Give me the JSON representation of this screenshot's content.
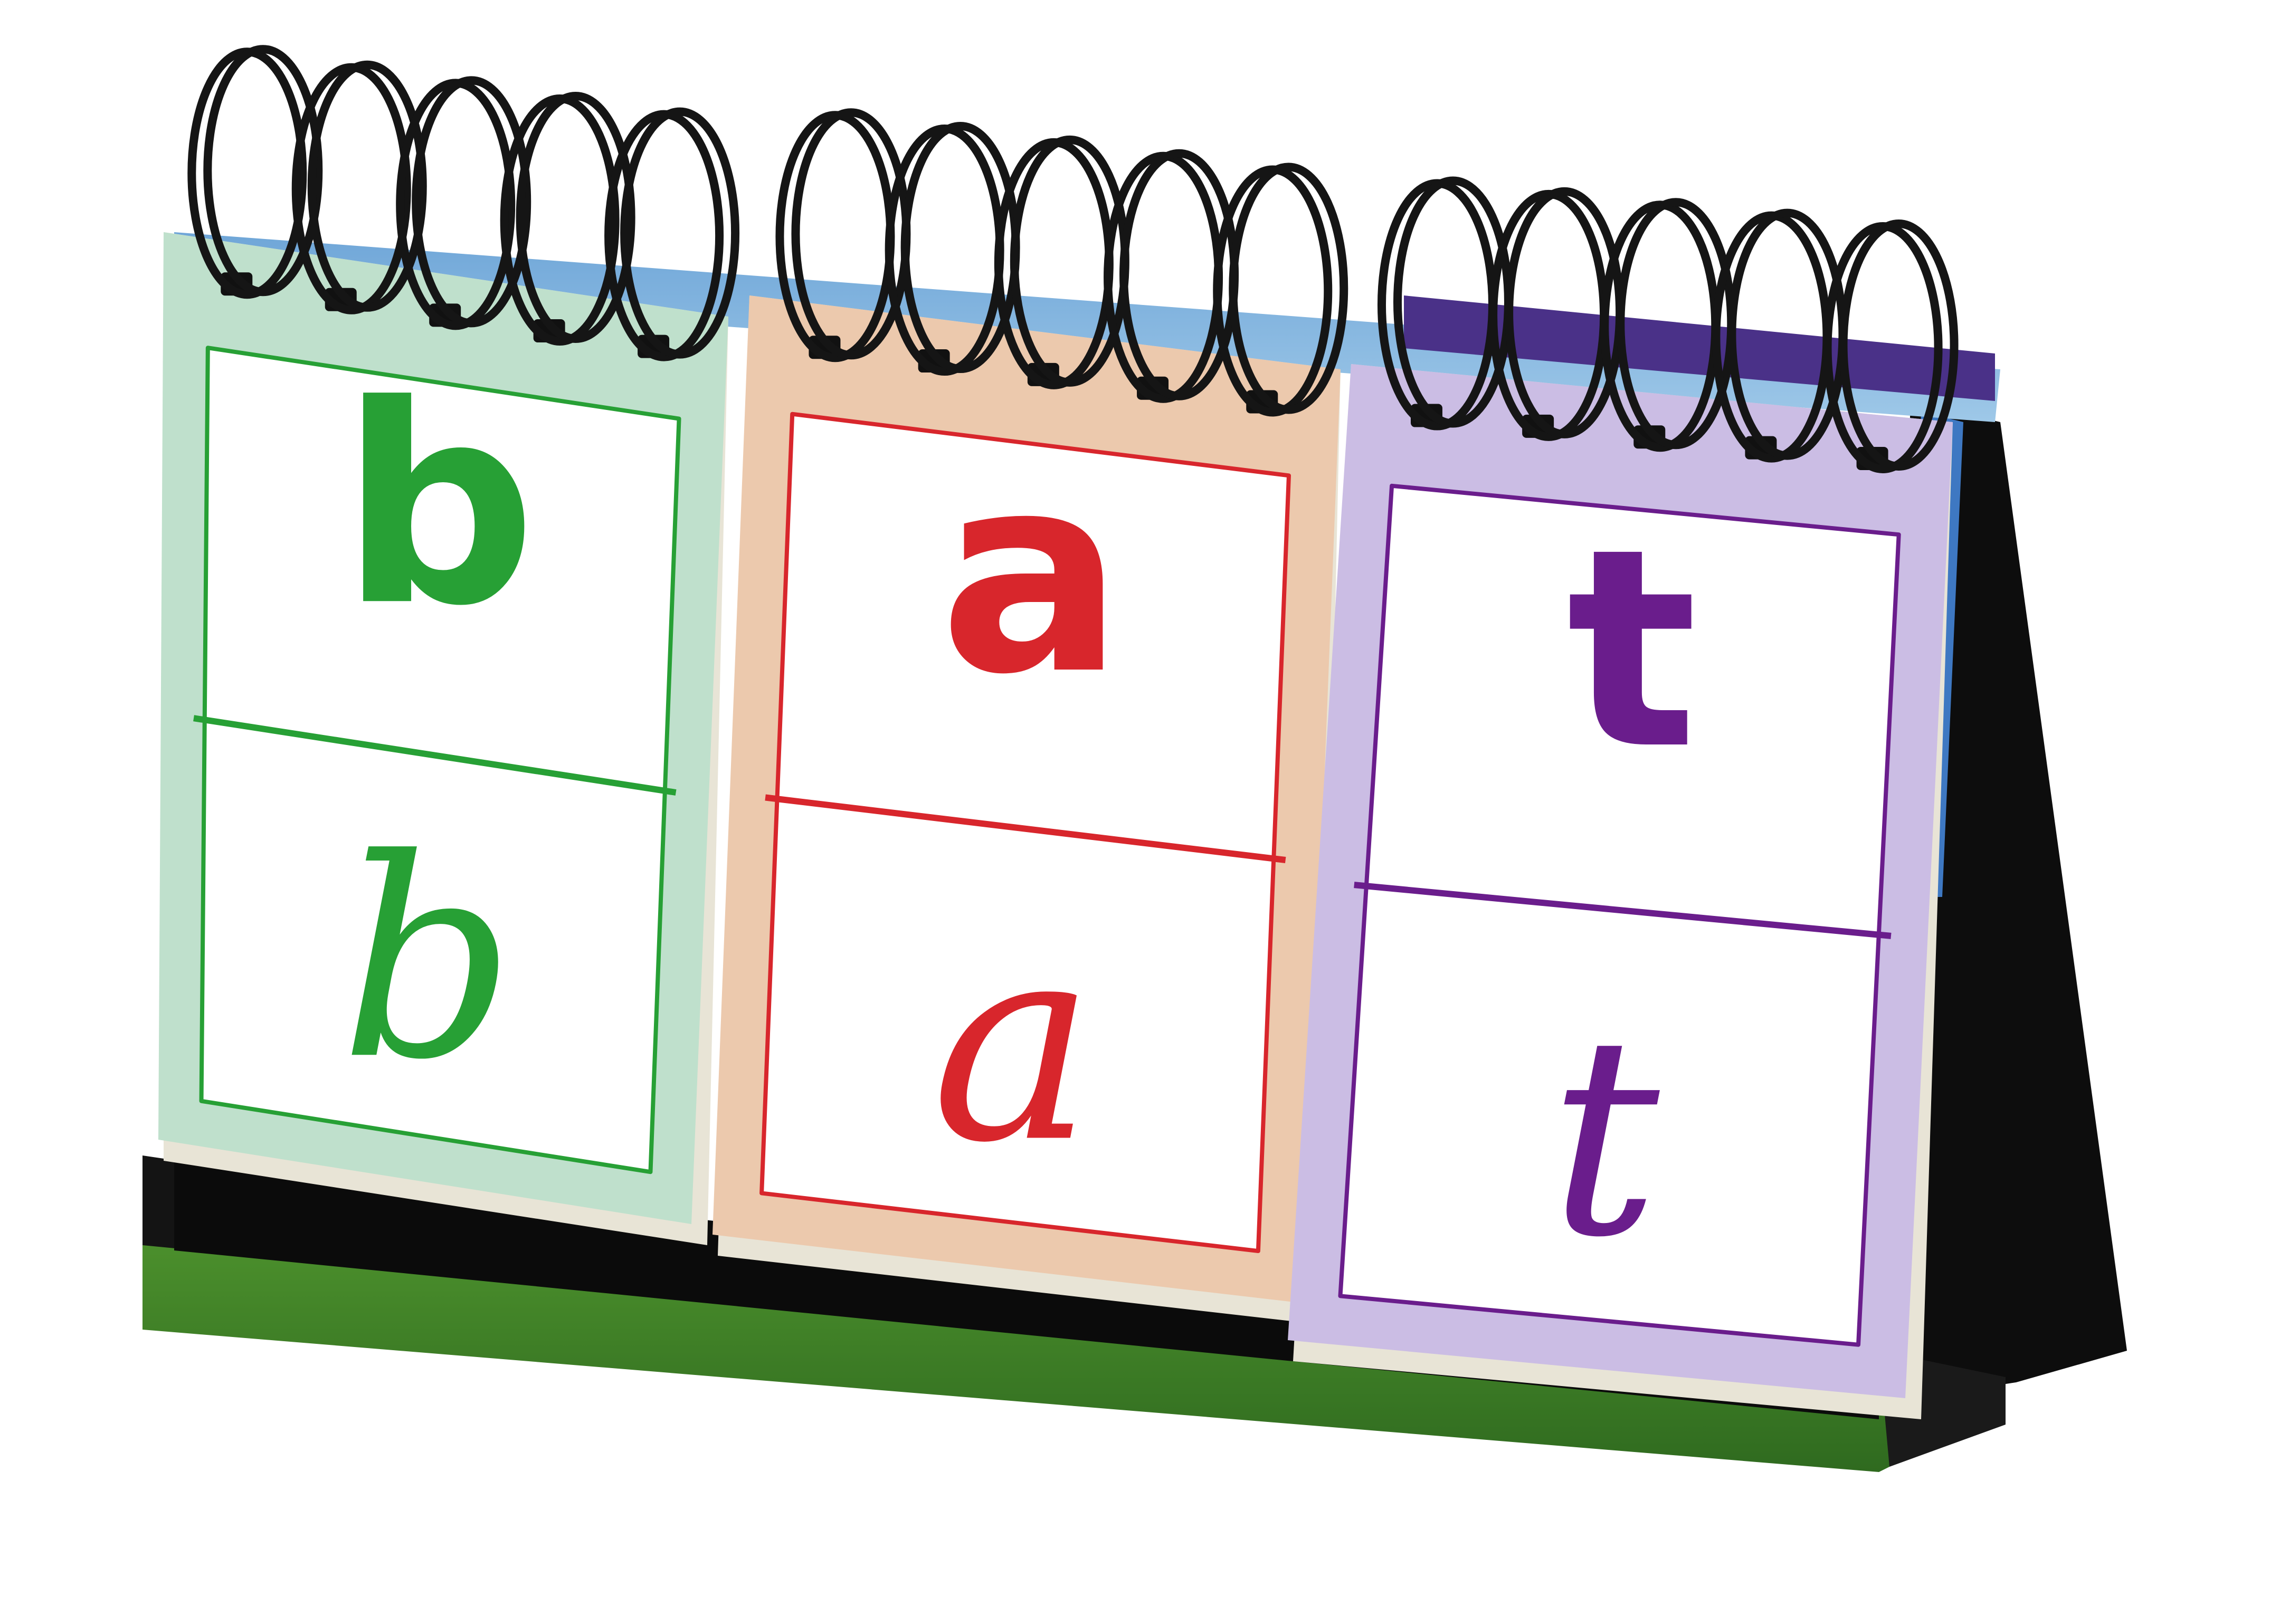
{
  "flip_stand": {
    "cards": [
      {
        "print_letter": "b",
        "cursive_letter": "b",
        "color": "#27a035",
        "card_color": "#bfe0cc"
      },
      {
        "print_letter": "a",
        "cursive_letter": "a",
        "color": "#d8262c",
        "card_color": "#ecc9ad"
      },
      {
        "print_letter": "t",
        "cursive_letter": "t",
        "color": "#6a1d8c",
        "card_color": "#cbbde4"
      }
    ],
    "stand_color": "#111111",
    "ring_color": "#151515"
  }
}
